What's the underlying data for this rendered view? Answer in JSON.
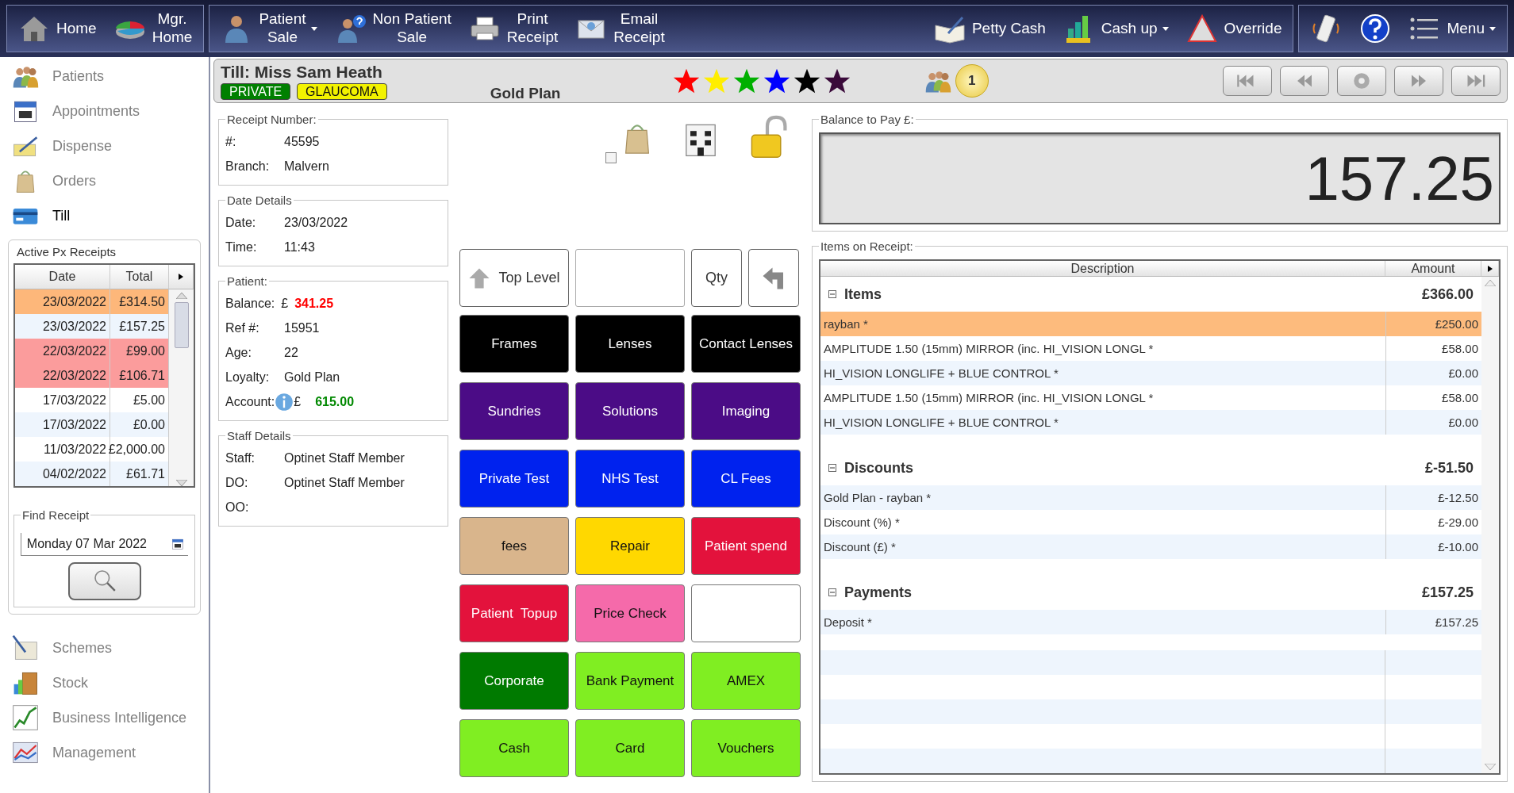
{
  "toolbar": {
    "groups": [
      {
        "items": [
          {
            "label": "Home",
            "dropdown": false
          },
          {
            "label": "Mgr.\nHome",
            "dropdown": false
          }
        ]
      },
      {
        "items": [
          {
            "label": "Patient\nSale",
            "dropdown": true
          },
          {
            "label": "Non Patient\nSale",
            "dropdown": false
          },
          {
            "label": "Print\nReceipt",
            "dropdown": false
          },
          {
            "label": "Email\nReceipt",
            "dropdown": false
          }
        ],
        "end_items": [
          {
            "label": "Petty Cash",
            "dropdown": false
          },
          {
            "label": "Cash up",
            "dropdown": true
          },
          {
            "label": "Override",
            "dropdown": false
          }
        ]
      },
      {
        "items": [
          {
            "dropdown": false
          },
          {
            "dropdown": false
          },
          {
            "label": "Menu",
            "dropdown": true
          }
        ]
      }
    ]
  },
  "order_checkbox": {
    "checked": false
  },
  "sidebar": {
    "items": [
      {
        "label": "Patients",
        "selected": false
      },
      {
        "label": "Appointments",
        "selected": false
      },
      {
        "label": "Dispense",
        "selected": false
      },
      {
        "label": "Orders",
        "selected": false
      },
      {
        "label": "Till",
        "selected": true
      }
    ],
    "active_receipts": {
      "title": "Active Px Receipts",
      "columns": [
        "Date",
        "Total"
      ],
      "rows": [
        {
          "date": "23/03/2022",
          "total": "£314.50",
          "color": "#fdb77a"
        },
        {
          "date": "23/03/2022",
          "total": "£157.25"
        },
        {
          "date": "22/03/2022",
          "total": "£99.00",
          "color": "#fb9c9c"
        },
        {
          "date": "22/03/2022",
          "total": "£106.71",
          "color": "#fb9c9c"
        },
        {
          "date": "17/03/2022",
          "total": "£5.00"
        },
        {
          "date": "17/03/2022",
          "total": "£0.00"
        },
        {
          "date": "11/03/2022",
          "total": "£2,000.00"
        },
        {
          "date": "04/02/2022",
          "total": "£61.71"
        }
      ]
    },
    "find_receipt": {
      "title": "Find Receipt",
      "date": "Monday 07 Mar 2022"
    },
    "bottom_items": [
      {
        "label": "Schemes",
        "selected": false
      },
      {
        "label": "Stock",
        "selected": false
      },
      {
        "label": "Business Intelligence",
        "selected": false
      },
      {
        "label": "Management",
        "selected": false
      }
    ]
  },
  "header": {
    "title": "Till: Miss Sam Heath",
    "tags": [
      {
        "label": "PRIVATE",
        "color": "#008000"
      },
      {
        "label": "GLAUCOMA",
        "color": "#f2f200"
      }
    ],
    "plan": "Gold Plan",
    "stars": [
      {
        "color": "#ff0000"
      },
      {
        "color": "#ffee00"
      },
      {
        "color": "#00b000"
      },
      {
        "color": "#0000ff"
      },
      {
        "color": "#000000"
      },
      {
        "color": "#3a0a3a"
      }
    ],
    "patient_count": "1"
  },
  "receipt_number": {
    "title": "Receipt Number:",
    "fields": [
      {
        "label": "#:",
        "value": "45595"
      },
      {
        "label": "Branch:",
        "value": "Malvern"
      }
    ]
  },
  "date_details": {
    "title": "Date Details",
    "fields": [
      {
        "label": "Date:",
        "value": "23/03/2022"
      },
      {
        "label": "Time:",
        "value": "11:43"
      }
    ]
  },
  "patient": {
    "title": "Patient:",
    "balance_label": "Balance:",
    "balance_currency": "£",
    "balance": "341.25",
    "fields": [
      {
        "label": "Ref #:",
        "value": "15951"
      },
      {
        "label": "Age:",
        "value": "22"
      },
      {
        "label": "Loyalty:",
        "value": "Gold Plan"
      }
    ],
    "account_label": "Account:",
    "account_currency": "£",
    "account": "615.00"
  },
  "staff_details": {
    "title": "Staff Details",
    "fields": [
      {
        "label": "Staff:",
        "value": "Optinet Staff Member"
      },
      {
        "label": "DO:",
        "value": "Optinet Staff Member"
      },
      {
        "label": "OO:"
      }
    ]
  },
  "keypad_row": [
    {
      "kind": "button",
      "label": "Top Level"
    },
    {
      "kind": "field"
    },
    {
      "kind": "button",
      "label": "Qty"
    },
    {
      "kind": "back"
    }
  ],
  "buttons": [
    {
      "label": "Frames",
      "color": "#000000"
    },
    {
      "label": "Lenses",
      "color": "#000000"
    },
    {
      "label": "Contact Lenses",
      "color": "#000000"
    },
    {
      "label": "Sundries",
      "color": "#4b0c86"
    },
    {
      "label": "Solutions",
      "color": "#4b0c86"
    },
    {
      "label": "Imaging",
      "color": "#4b0c86"
    },
    {
      "label": "Private Test",
      "color": "#0022ee"
    },
    {
      "label": "NHS Test",
      "color": "#0022ee"
    },
    {
      "label": "CL Fees",
      "color": "#0022ee"
    },
    {
      "label": "fees",
      "color": "#d9b58c"
    },
    {
      "label": "Repair",
      "color": "#ffd800"
    },
    {
      "label": "Patient spend",
      "color": "#e3123c"
    },
    {
      "label": "Patient  Topup",
      "color": "#e3123c"
    },
    {
      "label": "Price Check",
      "color": "#f56aaa"
    },
    {
      "color": "#ffffff"
    },
    {
      "label": "Corporate",
      "color": "#007a00"
    },
    {
      "label": "Bank Payment",
      "color": "#80ee22"
    },
    {
      "label": "AMEX",
      "color": "#80ee22"
    },
    {
      "label": "Cash",
      "color": "#80ee22"
    },
    {
      "label": "Card",
      "color": "#80ee22"
    },
    {
      "label": "Vouchers",
      "color": "#80ee22"
    }
  ],
  "balance": {
    "title": "Balance to Pay £:",
    "amount": "157.25"
  },
  "receipt": {
    "title": "Items on Receipt:",
    "columns": [
      "Description",
      "Amount"
    ],
    "groups": [
      {
        "title": "Items",
        "total": "£366.00",
        "expanded": true,
        "rows": [
          {
            "description": "rayban *",
            "amount": "£250.00",
            "selected": true
          },
          {
            "description": "AMPLITUDE 1.50 (15mm) MIRROR (inc. HI_VISION LONGL *",
            "amount": "£58.00",
            "selected": false
          },
          {
            "description": "HI_VISION LONGLIFE + BLUE CONTROL *",
            "amount": "£0.00",
            "selected": false
          },
          {
            "description": "AMPLITUDE 1.50 (15mm) MIRROR (inc. HI_VISION LONGL *",
            "amount": "£58.00",
            "selected": false
          },
          {
            "description": "HI_VISION LONGLIFE + BLUE CONTROL *",
            "amount": "£0.00",
            "selected": false
          }
        ]
      },
      {
        "title": "Discounts",
        "total": "£-51.50",
        "expanded": true,
        "rows": [
          {
            "description": "Gold Plan - rayban *",
            "amount": "£-12.50",
            "selected": false
          },
          {
            "description": "Discount (%) *",
            "amount": "£-29.00",
            "selected": false
          },
          {
            "description": "Discount (£) *",
            "amount": "£-10.00",
            "selected": false
          }
        ]
      },
      {
        "title": "Payments",
        "total": "£157.25",
        "expanded": true,
        "rows": [
          {
            "description": "Deposit *",
            "amount": "£157.25",
            "selected": false
          }
        ]
      }
    ]
  }
}
